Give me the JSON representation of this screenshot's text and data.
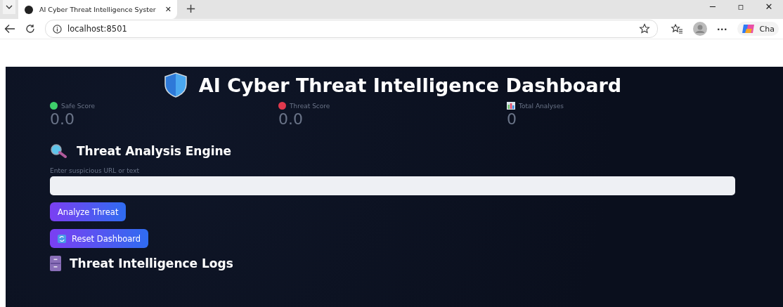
{
  "browser": {
    "tab_title": "AI Cyber Threat Intelligence Syster",
    "tab_close": "✕",
    "new_tab": "+",
    "window_controls": [
      "─",
      "▫",
      "✕"
    ],
    "url": "localhost:8501",
    "copilot_label": "Cha",
    "more": "···"
  },
  "dashboard": {
    "title": "AI Cyber Threat Intelligence Dashboard",
    "metrics": [
      {
        "kind": "dot",
        "color": "#3ecf6a",
        "label": "Safe Score",
        "value": "0.0"
      },
      {
        "kind": "dot",
        "color": "#e0394d",
        "label": "Threat Score",
        "value": "0.0"
      },
      {
        "kind": "chart",
        "label": "Total Analyses",
        "value": "0"
      }
    ],
    "analysis": {
      "heading": "Threat Analysis Engine",
      "field_label": "Enter suspicious URL or text",
      "buttons": [
        {
          "kind": "plain",
          "label": "Analyze Threat"
        },
        {
          "kind": "reset",
          "label": "Reset Dashboard"
        }
      ]
    },
    "logs": {
      "heading": "Threat Intelligence Logs"
    }
  }
}
